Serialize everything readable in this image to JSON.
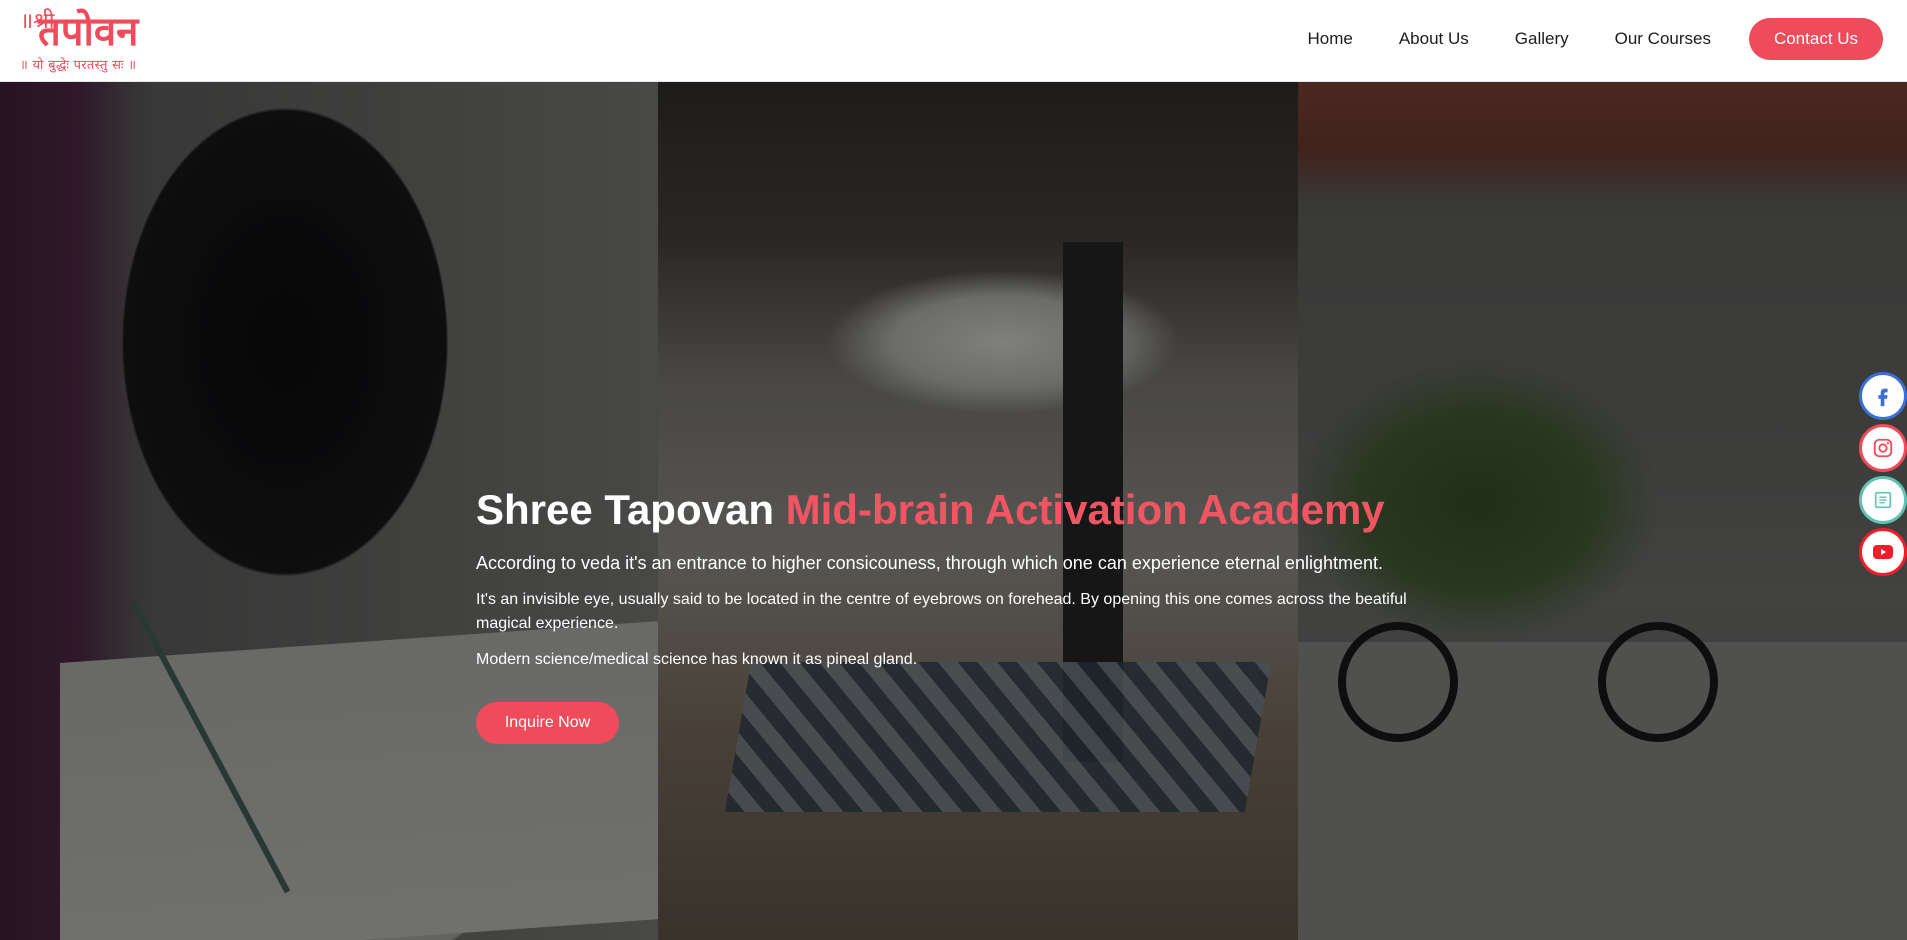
{
  "logo": {
    "mark": "॥श्री",
    "title": "तपोवन",
    "tagline": "॥ यो बुद्धेः परतस्तु सः ॥"
  },
  "nav": {
    "items": [
      "Home",
      "About Us",
      "Gallery",
      "Our Courses"
    ],
    "contact_label": "Contact Us"
  },
  "hero": {
    "title_plain": "Shree Tapovan ",
    "title_accent": "Mid-brain Activation Academy",
    "lead": "According to veda it's an entrance to higher consicouness, through which one can experience eternal enlightment.",
    "paragraph": "It's an invisible eye, usually said to be located in the centre of eyebrows on forehead. By opening this one comes across the beatiful magical experience.",
    "paragraph2": "Modern science/medical science has known it as pineal gland.",
    "cta_label": "Inquire Now"
  },
  "social": {
    "items": [
      {
        "icon": "facebook-icon",
        "color": "#3b6fd8"
      },
      {
        "icon": "instagram-icon",
        "color": "#ef4b5a"
      },
      {
        "icon": "book-icon",
        "color": "#5fc2b4"
      },
      {
        "icon": "youtube-icon",
        "color": "#ef1e2a"
      }
    ]
  },
  "colors": {
    "accent": "#ef4b5a",
    "title_accent": "#f15563",
    "nav_text": "#1c1c1c"
  }
}
